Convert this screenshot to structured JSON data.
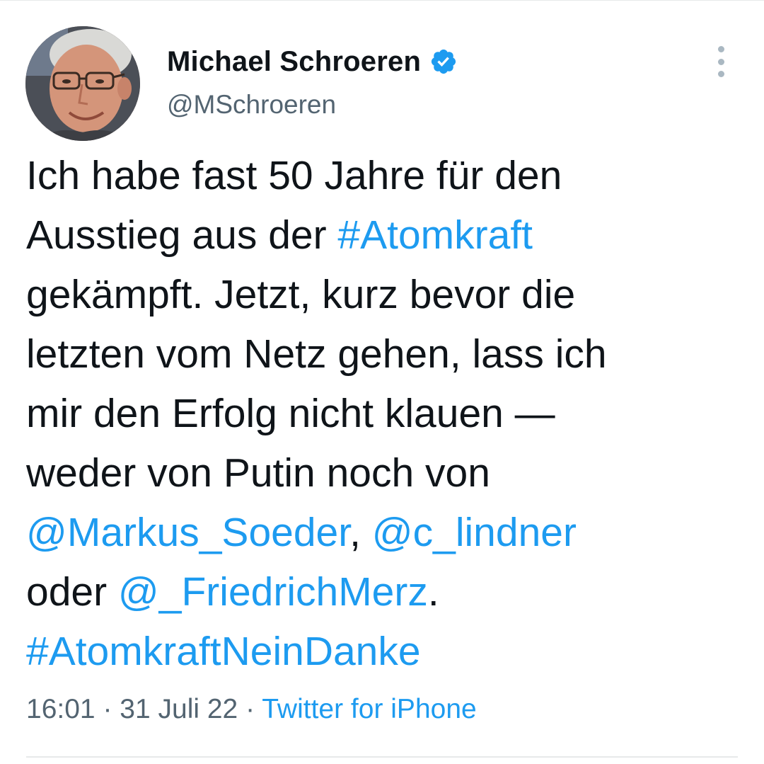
{
  "tweet": {
    "author": {
      "display_name": "Michael Schroeren",
      "handle": "@MSchroeren",
      "verified": true
    },
    "text_lines": [
      [
        {
          "t": "Ich habe fast 50 Jahre für den"
        }
      ],
      [
        {
          "t": "Ausstieg aus der "
        },
        {
          "t": "#Atomkraft",
          "link": true
        }
      ],
      [
        {
          "t": "gekämpft. Jetzt, kurz bevor die"
        }
      ],
      [
        {
          "t": "letzten vom Netz gehen, lass ich"
        }
      ],
      [
        {
          "t": "mir den Erfolg nicht klauen —"
        }
      ],
      [
        {
          "t": "weder von Putin noch von"
        }
      ],
      [
        {
          "t": "@Markus_Soeder",
          "link": true
        },
        {
          "t": ", "
        },
        {
          "t": "@c_lindner",
          "link": true
        }
      ],
      [
        {
          "t": "oder "
        },
        {
          "t": "@_FriedrichMerz",
          "link": true
        },
        {
          "t": "."
        }
      ],
      [
        {
          "t": "#AtomkraftNeinDanke",
          "link": true
        }
      ]
    ],
    "time": "16:01",
    "date": "31 Juli 22",
    "separator": "·",
    "source": "Twitter for iPhone"
  },
  "icons": {
    "verified": "verified-badge-icon",
    "more": "more-vertical-icon"
  },
  "colors": {
    "link": "#1d9bf0",
    "text": "#0f1419",
    "secondary": "#536471",
    "divider": "#e7e9ea"
  }
}
